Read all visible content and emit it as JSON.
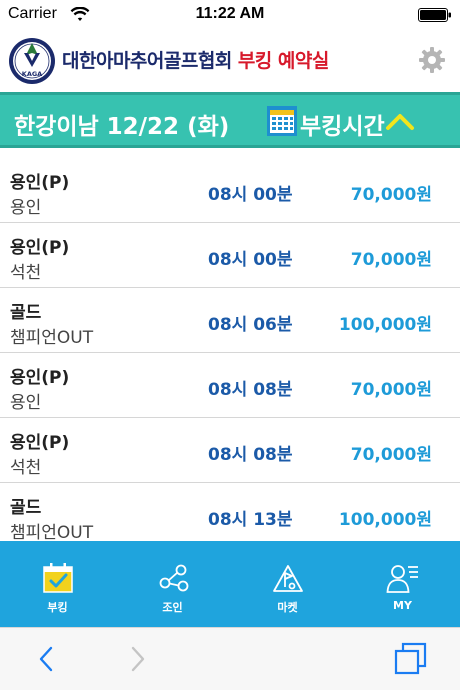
{
  "status_bar": {
    "carrier": "Carrier",
    "time": "11:22 AM",
    "icons": [
      "wifi-icon",
      "battery-icon"
    ]
  },
  "header": {
    "logo_text": "KAGA",
    "org_name": "대한아마추어골프협회",
    "page_name": "부킹 예약실",
    "settings_icon": "gear-icon",
    "colors": {
      "org": "#1b2a6b",
      "page": "#d7192b"
    }
  },
  "title_bar": {
    "title": "한강이남 12/22 (화)",
    "section": "부킹시간",
    "calendar_icon": "calendar-icon",
    "toggle_icon": "chevron-up-icon",
    "color": "#37c2b0"
  },
  "bookings": [
    {
      "course": "용인(P)",
      "sub": "용인",
      "time": "08시 00분",
      "price": "70,000원"
    },
    {
      "course": "용인(P)",
      "sub": "석천",
      "time": "08시 00분",
      "price": "70,000원"
    },
    {
      "course": "골드",
      "sub": "챔피언OUT",
      "time": "08시 06분",
      "price": "100,000원"
    },
    {
      "course": "용인(P)",
      "sub": "용인",
      "time": "08시 08분",
      "price": "70,000원"
    },
    {
      "course": "용인(P)",
      "sub": "석천",
      "time": "08시 08분",
      "price": "70,000원"
    },
    {
      "course": "골드",
      "sub": "챔피언OUT",
      "time": "08시 13분",
      "price": "100,000원"
    }
  ],
  "tabs": [
    {
      "label": "부킹",
      "icon": "calendar-check-icon",
      "active": true
    },
    {
      "label": "조인",
      "icon": "share-network-icon",
      "active": false
    },
    {
      "label": "마켓",
      "icon": "golf-market-icon",
      "active": false
    },
    {
      "label": "MY",
      "icon": "user-profile-icon",
      "active": false
    }
  ],
  "browser": {
    "icons": [
      "back-arrow-icon",
      "forward-arrow-icon",
      "tabs-icon"
    ]
  },
  "colors": {
    "time": "#1b5aa8",
    "price": "#1e9bd8",
    "tab_bar": "#1fa4dd",
    "active_tab_icon": "#f2d21c"
  }
}
